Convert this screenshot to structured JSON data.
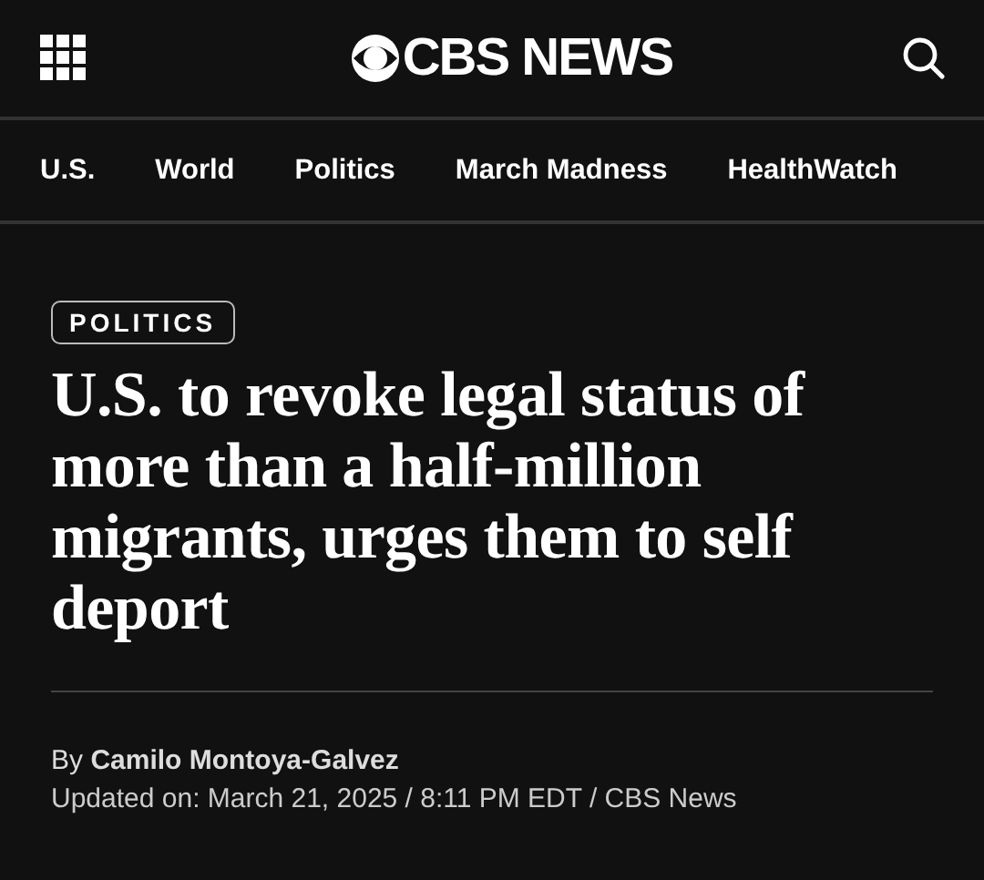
{
  "header": {
    "logo": "CBS NEWS"
  },
  "nav": [
    {
      "label": "U.S."
    },
    {
      "label": "World"
    },
    {
      "label": "Politics"
    },
    {
      "label": "March Madness"
    },
    {
      "label": "HealthWatch"
    }
  ],
  "article": {
    "section": "POLITICS",
    "headline": "U.S. to revoke legal status of more than a half-million migrants, urges them to self deport",
    "byline": "By **Camilo Montoya-Galvez**",
    "updated": "Updated on: March 21, 2025 / 8:11 PM EDT / CBS News"
  }
}
